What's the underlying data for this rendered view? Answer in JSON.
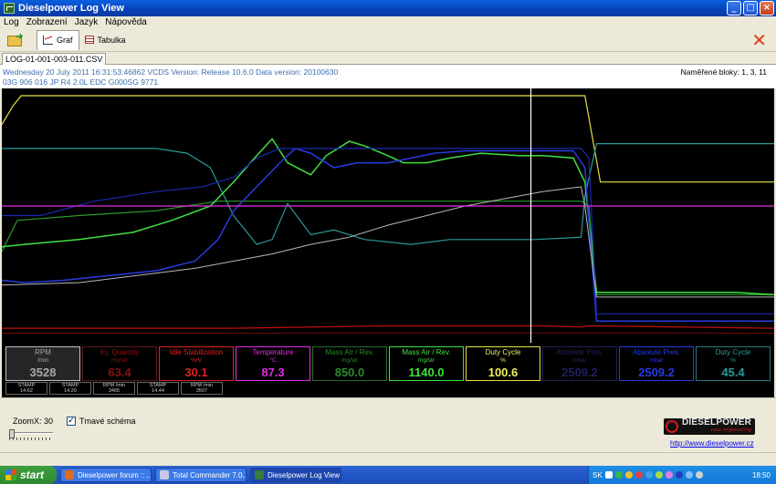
{
  "window": {
    "title": "Dieselpower Log View",
    "buttons": {
      "minimize": "_",
      "maximize": "□",
      "close": "×"
    }
  },
  "menu": [
    "Log",
    "Zobrazení",
    "Jazyk",
    "Nápověda"
  ],
  "toolbar": {
    "graf_label": "Graf",
    "tabulka_label": "Tabulka",
    "close_symbol": "✕"
  },
  "file_tab": "LOG-01-001-003-011.CSV",
  "info": {
    "line1": "Wednesday 20 July 2011 16:31:53:46862 VCDS Version: Release 10.6.0 Data version: 20100630",
    "line2": "03G 906 016 JP  R4 2.0L EDC G000SG  9771",
    "blocks": "Naměřené bloky: 1, 3, 11"
  },
  "colors": {
    "rpm": "#a8a8a8",
    "inj": "#8a1010",
    "idle": "#e02020",
    "temp": "#e030e0",
    "maf1": "#2a9a2a",
    "maf2": "#40e040",
    "duty": "#e8e040",
    "abs1": "#282878",
    "abs2": "#2a3ae0",
    "duty2": "#2a9a9a"
  },
  "gauges": [
    {
      "title": "RPM",
      "unit": "/min",
      "value": "3528",
      "color": "#a8a8a8",
      "border": "#c0c0c0",
      "bg": "#262626"
    },
    {
      "title": "Inj. Quantity",
      "unit": "mg/str",
      "value": "63.4",
      "color": "#8a1010",
      "border": "#5a1a1a",
      "bg": "#000000"
    },
    {
      "title": "Idle Stabilization",
      "unit": "%/V",
      "value": "30.1",
      "color": "#e02020",
      "border": "#e02020",
      "bg": "#000000"
    },
    {
      "title": "Temperature",
      "unit": "°C",
      "value": "87.3",
      "color": "#e030e0",
      "border": "#e030e0",
      "bg": "#000000"
    },
    {
      "title": "Mass Air / Rev.",
      "unit": "mg/str",
      "value": "850.0",
      "color": "#2a8a2a",
      "border": "#2a6a2a",
      "bg": "#000000"
    },
    {
      "title": "Mass Air / Rev.",
      "unit": "mg/str",
      "value": "1140.0",
      "color": "#40e040",
      "border": "#40e040",
      "bg": "#000000"
    },
    {
      "title": "Duty Cycle",
      "unit": "%",
      "value": "100.6",
      "color": "#f0f060",
      "border": "#e8e040",
      "bg": "#000000"
    },
    {
      "title": "Absolute Pres.",
      "unit": "mbar",
      "value": "2509.2",
      "color": "#202060",
      "border": "#202050",
      "bg": "#000000"
    },
    {
      "title": "Absolute Pres.",
      "unit": "mbar",
      "value": "2509.2",
      "color": "#2a3ae0",
      "border": "#2a3ae0",
      "bg": "#000000"
    },
    {
      "title": "Duty Cycle",
      "unit": "%",
      "value": "45.4",
      "color": "#2a9a9a",
      "border": "#2a7a7a",
      "bg": "#000000"
    }
  ],
  "stamps": [
    {
      "label": "STAMP",
      "value": "14.62"
    },
    {
      "label": "STAMP",
      "value": "14.20"
    },
    {
      "label": "RPM /min",
      "value": "3465"
    },
    {
      "label": "STAMP",
      "value": "14.44"
    },
    {
      "label": "RPM /min",
      "value": "3507"
    }
  ],
  "bottom": {
    "zoom_label": "ZoomX: 30",
    "zoom_level": 0.0,
    "dark_label": "Tmavé schéma",
    "dark_checked": "✓",
    "logo_text": "DIESELPOWER",
    "logo_sub": "race engineering",
    "url": "http://www.dieselpower.cz"
  },
  "taskbar": {
    "start": "start",
    "tasks": [
      {
        "label": "Dieselpower forum :: ...",
        "color": "#e06a1a"
      },
      {
        "label": "Total Commander 7.0...",
        "color": "#c8c8e8"
      },
      {
        "label": "Dieselpower Log View",
        "color": "#3a7a3a"
      }
    ],
    "lang": "SK",
    "clock": "18:50"
  },
  "chart_data": {
    "type": "line",
    "x_range": [
      0,
      100
    ],
    "y_range": [
      0,
      100
    ],
    "cursor_x": 68.5,
    "series": [
      {
        "color": "#e8e040",
        "width": 1.2,
        "points": [
          [
            0,
            88
          ],
          [
            1.5,
            96
          ],
          [
            2.5,
            100
          ],
          [
            75.5,
            100
          ],
          [
            77.5,
            64
          ],
          [
            100,
            64
          ]
        ]
      },
      {
        "color": "#2a9a9a",
        "width": 1.2,
        "points": [
          [
            0,
            78
          ],
          [
            20,
            78
          ],
          [
            24,
            76
          ],
          [
            27,
            70
          ],
          [
            30,
            50
          ],
          [
            33,
            38
          ],
          [
            35,
            40
          ],
          [
            37,
            55
          ],
          [
            40,
            42
          ],
          [
            43,
            44
          ],
          [
            47,
            40
          ],
          [
            53,
            38
          ],
          [
            58,
            40
          ],
          [
            63,
            40
          ],
          [
            69,
            40
          ],
          [
            75,
            41
          ],
          [
            75.5,
            58
          ],
          [
            77,
            80
          ],
          [
            78,
            80
          ],
          [
            100,
            80
          ]
        ]
      },
      {
        "color": "#2a9a2a",
        "width": 1.2,
        "points": [
          [
            0,
            35
          ],
          [
            2,
            48
          ],
          [
            10,
            50
          ],
          [
            20,
            52
          ],
          [
            28,
            56
          ],
          [
            35,
            56
          ],
          [
            42,
            56
          ],
          [
            50,
            56
          ],
          [
            60,
            56
          ],
          [
            69,
            56
          ],
          [
            75,
            56
          ],
          [
            76,
            54
          ],
          [
            77,
            17
          ],
          [
            100,
            17
          ]
        ]
      },
      {
        "color": "#40e040",
        "width": 1.5,
        "points": [
          [
            0,
            37
          ],
          [
            3,
            38
          ],
          [
            10,
            40
          ],
          [
            17,
            43
          ],
          [
            22,
            48
          ],
          [
            27,
            54
          ],
          [
            30,
            64
          ],
          [
            33,
            75
          ],
          [
            35,
            82
          ],
          [
            37,
            72
          ],
          [
            40,
            67
          ],
          [
            42,
            75
          ],
          [
            45,
            81
          ],
          [
            47,
            79
          ],
          [
            50,
            75
          ],
          [
            52,
            72
          ],
          [
            55,
            72
          ],
          [
            58,
            74
          ],
          [
            62,
            76
          ],
          [
            67,
            75
          ],
          [
            70,
            75
          ],
          [
            74,
            74
          ],
          [
            75.5,
            64
          ],
          [
            77,
            18
          ],
          [
            80,
            18
          ],
          [
            95,
            18
          ],
          [
            100,
            17
          ]
        ]
      },
      {
        "color": "#2a3ae0",
        "width": 1.5,
        "points": [
          [
            0,
            23
          ],
          [
            3,
            22
          ],
          [
            8,
            23
          ],
          [
            14,
            25
          ],
          [
            20,
            27
          ],
          [
            25,
            31
          ],
          [
            28,
            40
          ],
          [
            30,
            52
          ],
          [
            33,
            62
          ],
          [
            36,
            72
          ],
          [
            38,
            78
          ],
          [
            40,
            76
          ],
          [
            43,
            70
          ],
          [
            46,
            72
          ],
          [
            50,
            72
          ],
          [
            53,
            74
          ],
          [
            56,
            76
          ],
          [
            60,
            77
          ],
          [
            64,
            77
          ],
          [
            70,
            77
          ],
          [
            74,
            77
          ],
          [
            75.5,
            70
          ],
          [
            77,
            6
          ],
          [
            100,
            6
          ]
        ]
      },
      {
        "color": "#1a2ab0",
        "width": 1.2,
        "points": [
          [
            0,
            50
          ],
          [
            5,
            50
          ],
          [
            12,
            56
          ],
          [
            20,
            60
          ],
          [
            26,
            62
          ],
          [
            30,
            66
          ],
          [
            33,
            74
          ],
          [
            36,
            78
          ],
          [
            40,
            78
          ],
          [
            50,
            78
          ],
          [
            60,
            78
          ],
          [
            70,
            78
          ],
          [
            75,
            78
          ],
          [
            76,
            74
          ],
          [
            77,
            9
          ],
          [
            100,
            9
          ]
        ]
      },
      {
        "color": "#b8b8b8",
        "width": 1.0,
        "points": [
          [
            0,
            21
          ],
          [
            10,
            22
          ],
          [
            20,
            26
          ],
          [
            25,
            28
          ],
          [
            30,
            31
          ],
          [
            35,
            34
          ],
          [
            40,
            38
          ],
          [
            45,
            41
          ],
          [
            50,
            46
          ],
          [
            55,
            50
          ],
          [
            60,
            54
          ],
          [
            65,
            57
          ],
          [
            70,
            60
          ],
          [
            75,
            62
          ],
          [
            75.5,
            54
          ],
          [
            77,
            16
          ],
          [
            100,
            16
          ]
        ]
      },
      {
        "color": "#e030e0",
        "width": 1.2,
        "points": [
          [
            0,
            54
          ],
          [
            100,
            54
          ]
        ]
      },
      {
        "color": "#c01010",
        "width": 1.2,
        "points": [
          [
            0,
            3
          ],
          [
            30,
            3
          ],
          [
            50,
            4
          ],
          [
            70,
            4
          ],
          [
            75,
            3.5
          ],
          [
            76,
            4
          ],
          [
            100,
            3
          ]
        ]
      },
      {
        "color": "#700808",
        "width": 1.0,
        "points": [
          [
            0,
            1
          ],
          [
            100,
            1
          ]
        ]
      }
    ]
  }
}
